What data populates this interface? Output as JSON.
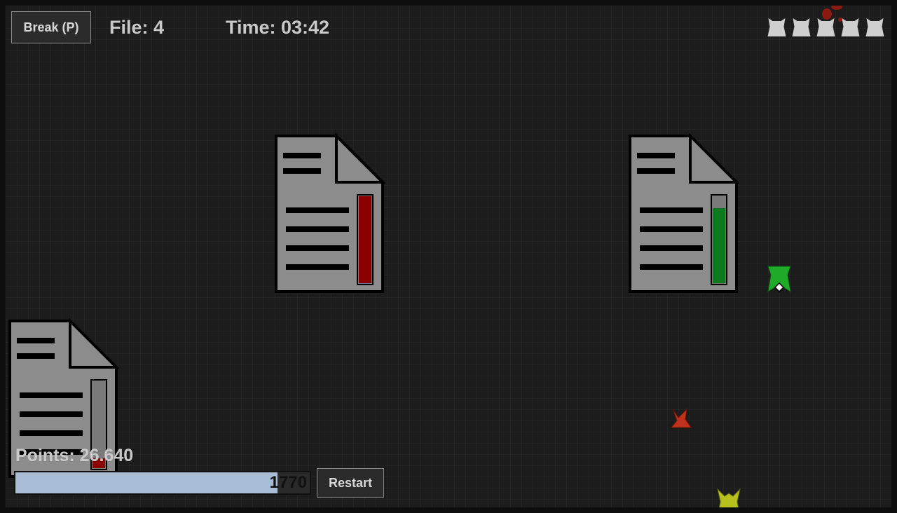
{
  "hud": {
    "break_button": "Break (P)",
    "file_label": "File: 4",
    "time_label": "Time: 03:42",
    "points_label": "Points: 26.640",
    "restart_button": "Restart",
    "progress_text": "1770",
    "progress_fraction": 0.89,
    "lives_count": 5
  },
  "documents": [
    {
      "name": "document-red",
      "meter_color": "#8b0000",
      "meter_level": 1.0
    },
    {
      "name": "document-green",
      "meter_color": "#0e7a1e",
      "meter_level": 0.86
    },
    {
      "name": "document-partial",
      "meter_color": "#8b0000",
      "meter_level": 0.1
    }
  ],
  "ships": [
    {
      "name": "player-ship",
      "color": "#1faa2a"
    },
    {
      "name": "enemy-ship-red",
      "color": "#c0321c"
    },
    {
      "name": "enemy-ship-yellow",
      "color": "#b7c11e"
    }
  ]
}
